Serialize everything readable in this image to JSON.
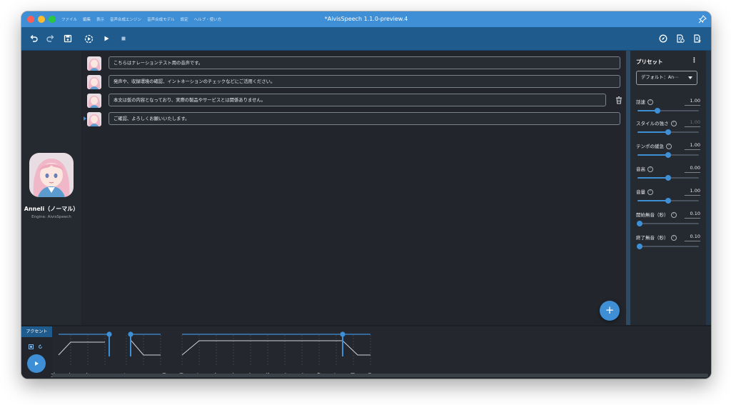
{
  "window": {
    "title": "*AivisSpeech 1.1.0-preview.4"
  },
  "menu": [
    "ファイル",
    "編集",
    "表示",
    "音声合成エンジン",
    "音声合成モデル",
    "設定",
    "ヘルプ・使い方"
  ],
  "toolbar": {
    "left_icons": [
      "undo-icon",
      "redo-icon",
      "save-icon",
      "continuous-play-icon",
      "play-icon",
      "stop-icon"
    ],
    "right_icons": [
      "compass-icon",
      "export-audio-icon",
      "export-text-icon"
    ]
  },
  "character": {
    "name": "Anneli（ノーマル）",
    "engine": "Engine: AivisSpeech"
  },
  "audio_items": [
    {
      "text": "こちらはナレーションテスト用の音声です。"
    },
    {
      "text": "発声や、収録環境の確認、イントネーションのチェックなどにご活用ください。"
    },
    {
      "text": "本文は仮の内容となっており、実際の製品やサービスとは関係ありません。"
    },
    {
      "text": "ご確認、よろしくお願いいたします。"
    }
  ],
  "preset": {
    "title": "プリセット",
    "selected": "デフォルト：An⋯"
  },
  "parameters": [
    {
      "label": "話速",
      "value": "1.00",
      "level": 0.33,
      "disabled": false
    },
    {
      "label": "スタイルの強さ",
      "value": "1.00",
      "level": 0.5,
      "disabled": true
    },
    {
      "label": "テンポの緩急",
      "value": "1.00",
      "level": 0.5,
      "disabled": false
    },
    {
      "label": "音高",
      "value": "0.00",
      "level": 0.5,
      "disabled": false
    },
    {
      "label": "音量",
      "value": "1.00",
      "level": 0.5,
      "disabled": false
    },
    {
      "label": "開始無音（秒）",
      "value": "0.10",
      "level": 0.04,
      "disabled": false
    },
    {
      "label": "終了無音（秒）",
      "value": "0.10",
      "level": 0.04,
      "disabled": false
    }
  ],
  "accent": {
    "tab_label": "アクセント",
    "moras": [
      "ゴ",
      "カ",
      "ク",
      "ニ",
      "ン",
      "、",
      "ヨ",
      "ロ",
      "シ",
      "ク",
      "オ",
      "ネ",
      "ガ",
      "イ",
      "イ",
      "タ",
      "シ",
      "マ",
      "ス",
      "。"
    ]
  },
  "colors": {
    "accent": "#3e8fd6",
    "titlebar": "#3e8fd6",
    "toolbar": "#1f5b8d"
  }
}
